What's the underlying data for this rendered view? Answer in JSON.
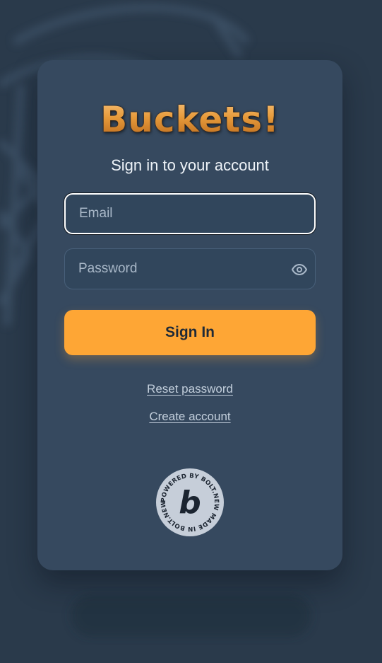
{
  "app": {
    "logo_text": "Buckets!",
    "subtitle": "Sign in to your account"
  },
  "form": {
    "email": {
      "placeholder": "Email",
      "value": ""
    },
    "password": {
      "placeholder": "Password",
      "value": "",
      "toggle_icon": "eye-icon"
    },
    "submit_label": "Sign In"
  },
  "links": {
    "reset_password": "Reset password",
    "create_account": "Create account"
  },
  "badge": {
    "ring_text": "POWERED BY BOLT.NEW MADE IN BOLT.NEW ",
    "letter": "b",
    "icon": "bolt-badge-icon"
  },
  "colors": {
    "background": "#2a3a4b",
    "card": "#36495f",
    "accent": "#fea635",
    "text": "#eef3f8",
    "link": "#c3cfdc"
  }
}
